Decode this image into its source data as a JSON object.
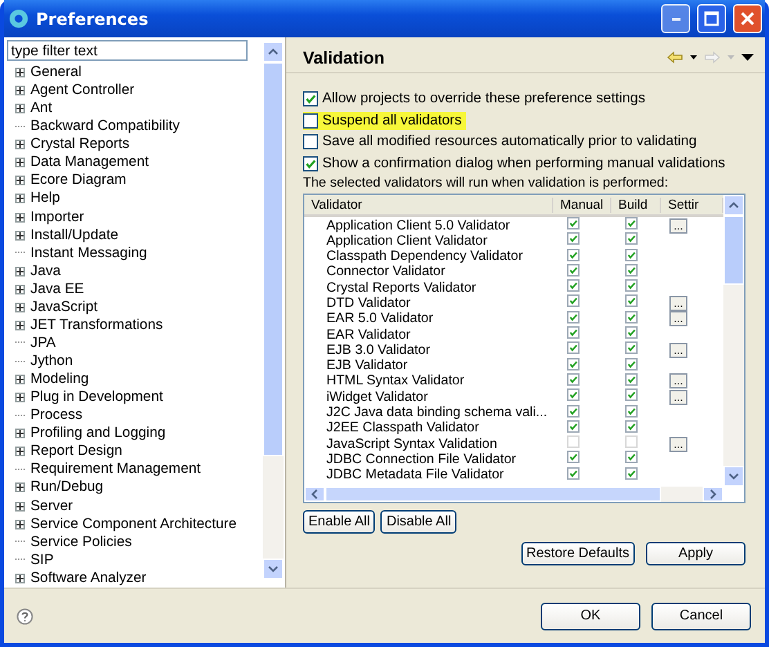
{
  "window": {
    "title": "Preferences"
  },
  "filter": {
    "placeholder": "type filter text"
  },
  "tree": [
    {
      "label": "General",
      "expandable": true
    },
    {
      "label": "Agent Controller",
      "expandable": true
    },
    {
      "label": "Ant",
      "expandable": true
    },
    {
      "label": "Backward Compatibility",
      "expandable": false
    },
    {
      "label": "Crystal Reports",
      "expandable": true
    },
    {
      "label": "Data Management",
      "expandable": true
    },
    {
      "label": "Ecore Diagram",
      "expandable": true
    },
    {
      "label": "Help",
      "expandable": true
    },
    {
      "label": "Importer",
      "expandable": true
    },
    {
      "label": "Install/Update",
      "expandable": true
    },
    {
      "label": "Instant Messaging",
      "expandable": false
    },
    {
      "label": "Java",
      "expandable": true
    },
    {
      "label": "Java EE",
      "expandable": true
    },
    {
      "label": "JavaScript",
      "expandable": true
    },
    {
      "label": "JET Transformations",
      "expandable": true
    },
    {
      "label": "JPA",
      "expandable": false
    },
    {
      "label": "Jython",
      "expandable": false
    },
    {
      "label": "Modeling",
      "expandable": true
    },
    {
      "label": "Plug in Development",
      "expandable": true
    },
    {
      "label": "Process",
      "expandable": false
    },
    {
      "label": "Profiling and Logging",
      "expandable": true
    },
    {
      "label": "Report Design",
      "expandable": true
    },
    {
      "label": "Requirement Management",
      "expandable": false
    },
    {
      "label": "Run/Debug",
      "expandable": true
    },
    {
      "label": "Server",
      "expandable": true
    },
    {
      "label": "Service Component Architecture",
      "expandable": true
    },
    {
      "label": "Service Policies",
      "expandable": false
    },
    {
      "label": "SIP",
      "expandable": false
    },
    {
      "label": "Software Analyzer",
      "expandable": true
    }
  ],
  "page": {
    "title": "Validation"
  },
  "options": [
    {
      "label": "Allow projects to override these preference settings",
      "checked": true,
      "highlighted": false
    },
    {
      "label": "Suspend all validators",
      "checked": false,
      "highlighted": true
    },
    {
      "label": "Save all modified resources automatically prior to validating",
      "checked": false,
      "highlighted": false
    },
    {
      "label": "Show a confirmation dialog when performing manual validations",
      "checked": true,
      "highlighted": false
    }
  ],
  "note": "The selected validators will run when validation is performed:",
  "table": {
    "columns": [
      "Validator",
      "Manual",
      "Build",
      "Settir"
    ],
    "rows": [
      {
        "name": "Application Client 5.0 Validator",
        "manual": true,
        "build": true,
        "settings": "..."
      },
      {
        "name": "Application Client Validator",
        "manual": true,
        "build": true
      },
      {
        "name": "Classpath Dependency Validator",
        "manual": true,
        "build": true
      },
      {
        "name": "Connector Validator",
        "manual": true,
        "build": true
      },
      {
        "name": "Crystal Reports Validator",
        "manual": true,
        "build": true
      },
      {
        "name": "DTD Validator",
        "manual": true,
        "build": true,
        "settings": "..."
      },
      {
        "name": "EAR 5.0 Validator",
        "manual": true,
        "build": true,
        "settings": "..."
      },
      {
        "name": "EAR Validator",
        "manual": true,
        "build": true
      },
      {
        "name": "EJB 3.0 Validator",
        "manual": true,
        "build": true,
        "settings": "..."
      },
      {
        "name": "EJB Validator",
        "manual": true,
        "build": true
      },
      {
        "name": "HTML Syntax Validator",
        "manual": true,
        "build": true,
        "settings": "..."
      },
      {
        "name": "iWidget Validator",
        "manual": true,
        "build": true,
        "settings": "..."
      },
      {
        "name": "J2C Java data binding schema vali...",
        "manual": true,
        "build": true
      },
      {
        "name": "J2EE Classpath Validator",
        "manual": true,
        "build": true
      },
      {
        "name": "JavaScript Syntax Validation",
        "manual": false,
        "build": false,
        "settings": "..."
      },
      {
        "name": "JDBC Connection File Validator",
        "manual": true,
        "build": true
      },
      {
        "name": "JDBC Metadata File Validator",
        "manual": true,
        "build": true
      }
    ]
  },
  "table_buttons": [
    "Enable All",
    "Disable All"
  ],
  "page_buttons": [
    "Restore Defaults",
    "Apply"
  ],
  "dialog_buttons": [
    "OK",
    "Cancel"
  ]
}
